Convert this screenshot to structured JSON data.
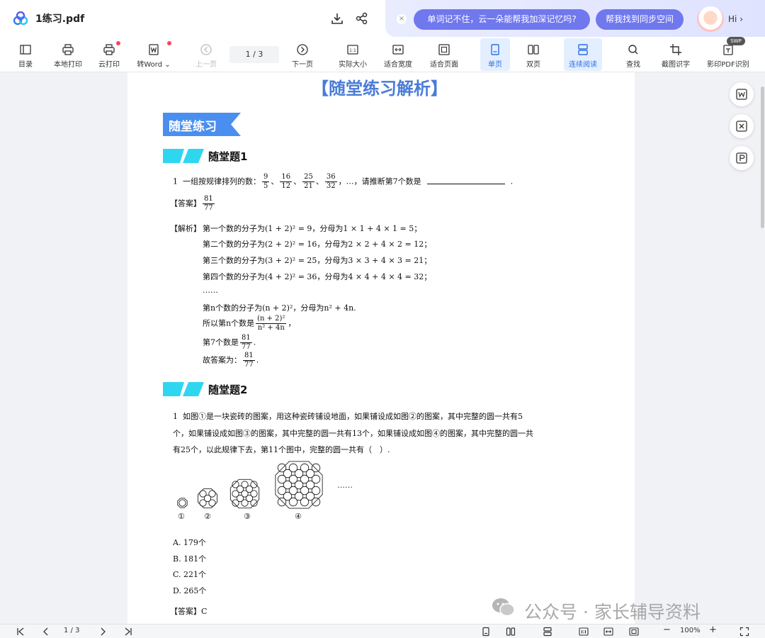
{
  "titlebar": {
    "file_name": "1练习.pdf",
    "ai_suggestion_1": "单词记不住，云一朵能帮我加深记忆吗?",
    "ai_suggestion_2": "帮我找到同步空间",
    "greeting": "Hi",
    "close_glyph": "×",
    "chevron_glyph": "›"
  },
  "toolbar": {
    "toc": "目录",
    "local_print": "本地打印",
    "cloud_print": "云打印",
    "to_word": "转Word",
    "to_word_caret": "⌄",
    "prev_page": "上一页",
    "page_indicator": "1 / 3",
    "next_page": "下一页",
    "actual_size": "实际大小",
    "actual_size_glyph": "1:1",
    "fit_width": "适合宽度",
    "fit_page": "适合页面",
    "single_page": "单页",
    "double_page": "双页",
    "continuous": "连续阅读",
    "find": "查找",
    "ocr_screenshot": "截图识字",
    "pdf_ocr": "影印PDF识别",
    "swp_badge": "SWP"
  },
  "document": {
    "title": "【随堂练习解析】",
    "section_label": "随堂练习",
    "q1": {
      "heading": "随堂题1",
      "number": "1",
      "stem_prefix": "一组按规律排列的数：",
      "fractions": [
        {
          "n": "9",
          "d": "5"
        },
        {
          "n": "16",
          "d": "12"
        },
        {
          "n": "25",
          "d": "21"
        },
        {
          "n": "36",
          "d": "32"
        }
      ],
      "stem_sep": "、",
      "stem_suffix": "，…，请推断第7个数是",
      "stem_end": ".",
      "answer_label": "【答案】",
      "answer": {
        "n": "81",
        "d": "77"
      },
      "analysis_label": "【解析】",
      "analysis_lines": [
        "第一个数的分子为(1 + 2)² = 9，分母为1 × 1 + 4 × 1 = 5；",
        "第二个数的分子为(2 + 2)² = 16，分母为2 × 2 + 4 × 2 = 12；",
        "第三个数的分子为(3 + 2)² = 25，分母为3 × 3 + 4 × 3 = 21；",
        "第四个数的分子为(4 + 2)² = 36，分母为4 × 4 + 4 × 4 = 32；",
        "……",
        "第n个数的分子为(n + 2)²，分母为n² + 4n."
      ],
      "general_prefix": "所以第n个数是",
      "general_frac": {
        "n": "(n + 2)²",
        "d": "n² + 4n"
      },
      "general_suffix": "，",
      "seventh_prefix": "第7个数是",
      "seventh_suffix": ".",
      "conclusion_prefix": "故答案为：",
      "conclusion_suffix": "."
    },
    "q2": {
      "heading": "随堂题2",
      "number": "1",
      "stem_lines": [
        "如图①是一块瓷砖的图案，用这种瓷砖铺设地面，如果铺设成如图②的图案，其中完整的圆一共有5",
        "个，如果铺设成如图③的图案，其中完整的圆一共有13个，如果铺设成如图④的图案，其中完整的圆一共",
        "有25个，以此规律下去，第11个图中，完整的圆一共有（　）."
      ],
      "figure_labels": [
        "①",
        "②",
        "③",
        "④"
      ],
      "figure_dots": "……",
      "options": [
        "A.  179个",
        "B.  181个",
        "C.  221个",
        "D.  265个"
      ],
      "answer_label": "【答案】",
      "answer": "C"
    }
  },
  "watermark": {
    "text": "公众号 · 家长辅导资料"
  },
  "statusbar": {
    "page_indicator": "1 / 3",
    "zoom": "100%",
    "zoom_out": "−",
    "zoom_in": "+"
  },
  "colors": {
    "accent_blue": "#2f6fe6",
    "title_blue": "#4a7bd8",
    "banner_blue": "#4a8ff0",
    "cyan_deco": "#2fd6f0",
    "ai_pill": "#7078ee",
    "red_dot": "#f5475a"
  }
}
